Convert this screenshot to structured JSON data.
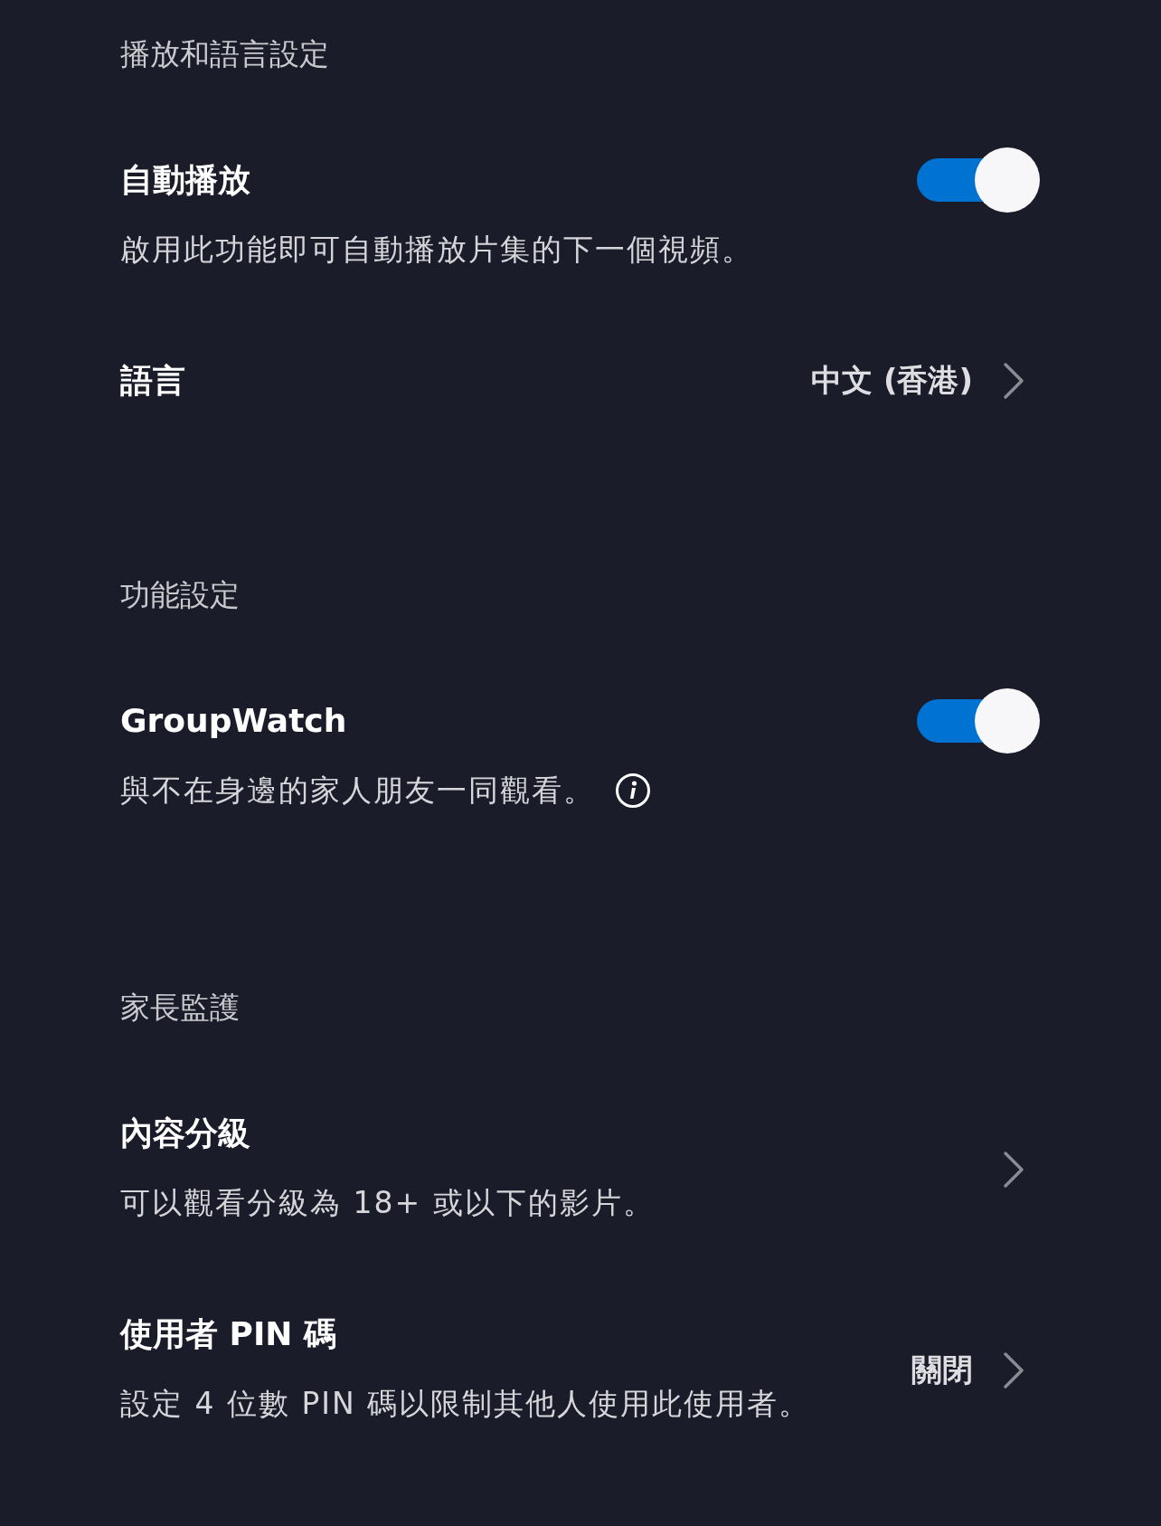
{
  "sections": [
    {
      "header": "播放和語言設定",
      "items": [
        {
          "kind": "toggle",
          "title": "自動播放",
          "description": "啟用此功能即可自動播放片集的下一個視頻。",
          "on": true
        },
        {
          "kind": "link",
          "title": "語言",
          "value": "中文 (香港)"
        }
      ]
    },
    {
      "header": "功能設定",
      "items": [
        {
          "kind": "toggle",
          "title": "GroupWatch",
          "description": "與不在身邊的家人朋友一同觀看。",
          "on": true,
          "info": true
        }
      ]
    },
    {
      "header": "家長監護",
      "items": [
        {
          "kind": "link",
          "title": "內容分級",
          "description": "可以觀看分級為 18+ 或以下的影片。"
        },
        {
          "kind": "link",
          "title": "使用者 PIN 碼",
          "description": "設定 4 位數 PIN 碼以限制其他人使用此使用者。",
          "value": "關閉"
        }
      ]
    }
  ]
}
